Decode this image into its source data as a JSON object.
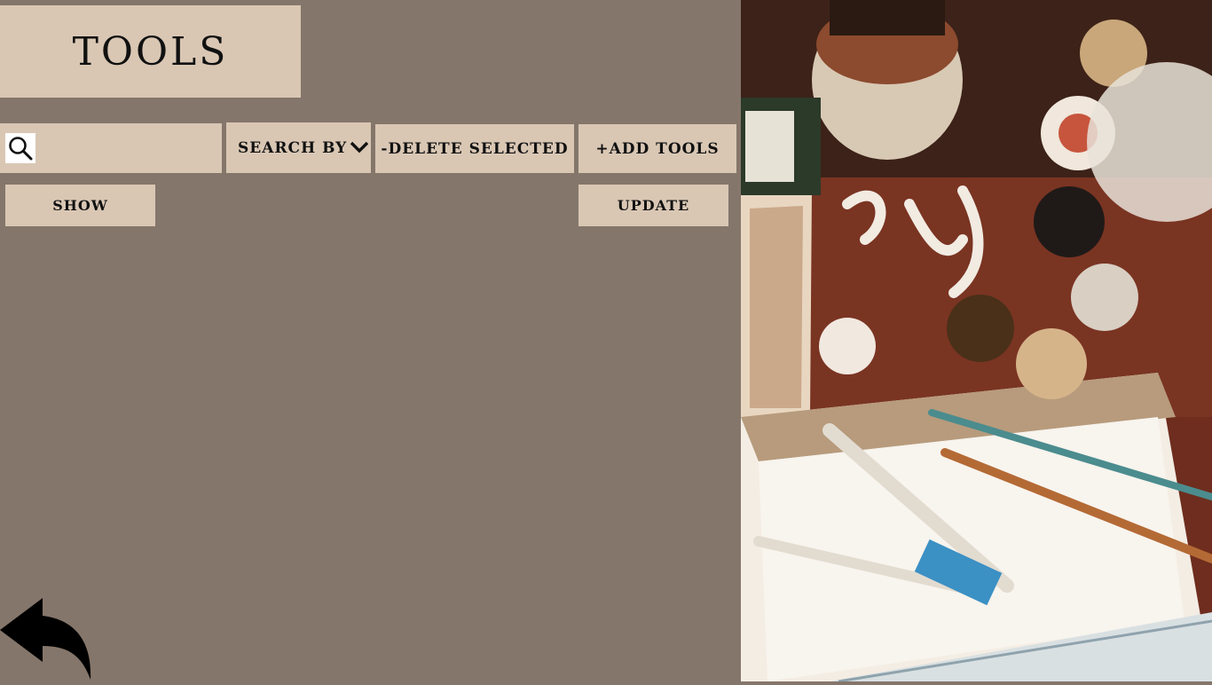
{
  "page": {
    "title": "TOOLS"
  },
  "search": {
    "placeholder": "",
    "value": "",
    "icon": "search-icon"
  },
  "toolbar": {
    "search_by_label": "SEARCH BY",
    "delete_label": "-DELETE SELECTED",
    "add_label": "+ADD TOOLS",
    "show_label": "SHOW",
    "update_label": "UPDATE"
  },
  "icons": {
    "back": "back-arrow-icon",
    "dropdown": "chevron-down-icon"
  },
  "colors": {
    "background": "#85766b",
    "button": "#d9c7b4",
    "text": "#111111"
  }
}
